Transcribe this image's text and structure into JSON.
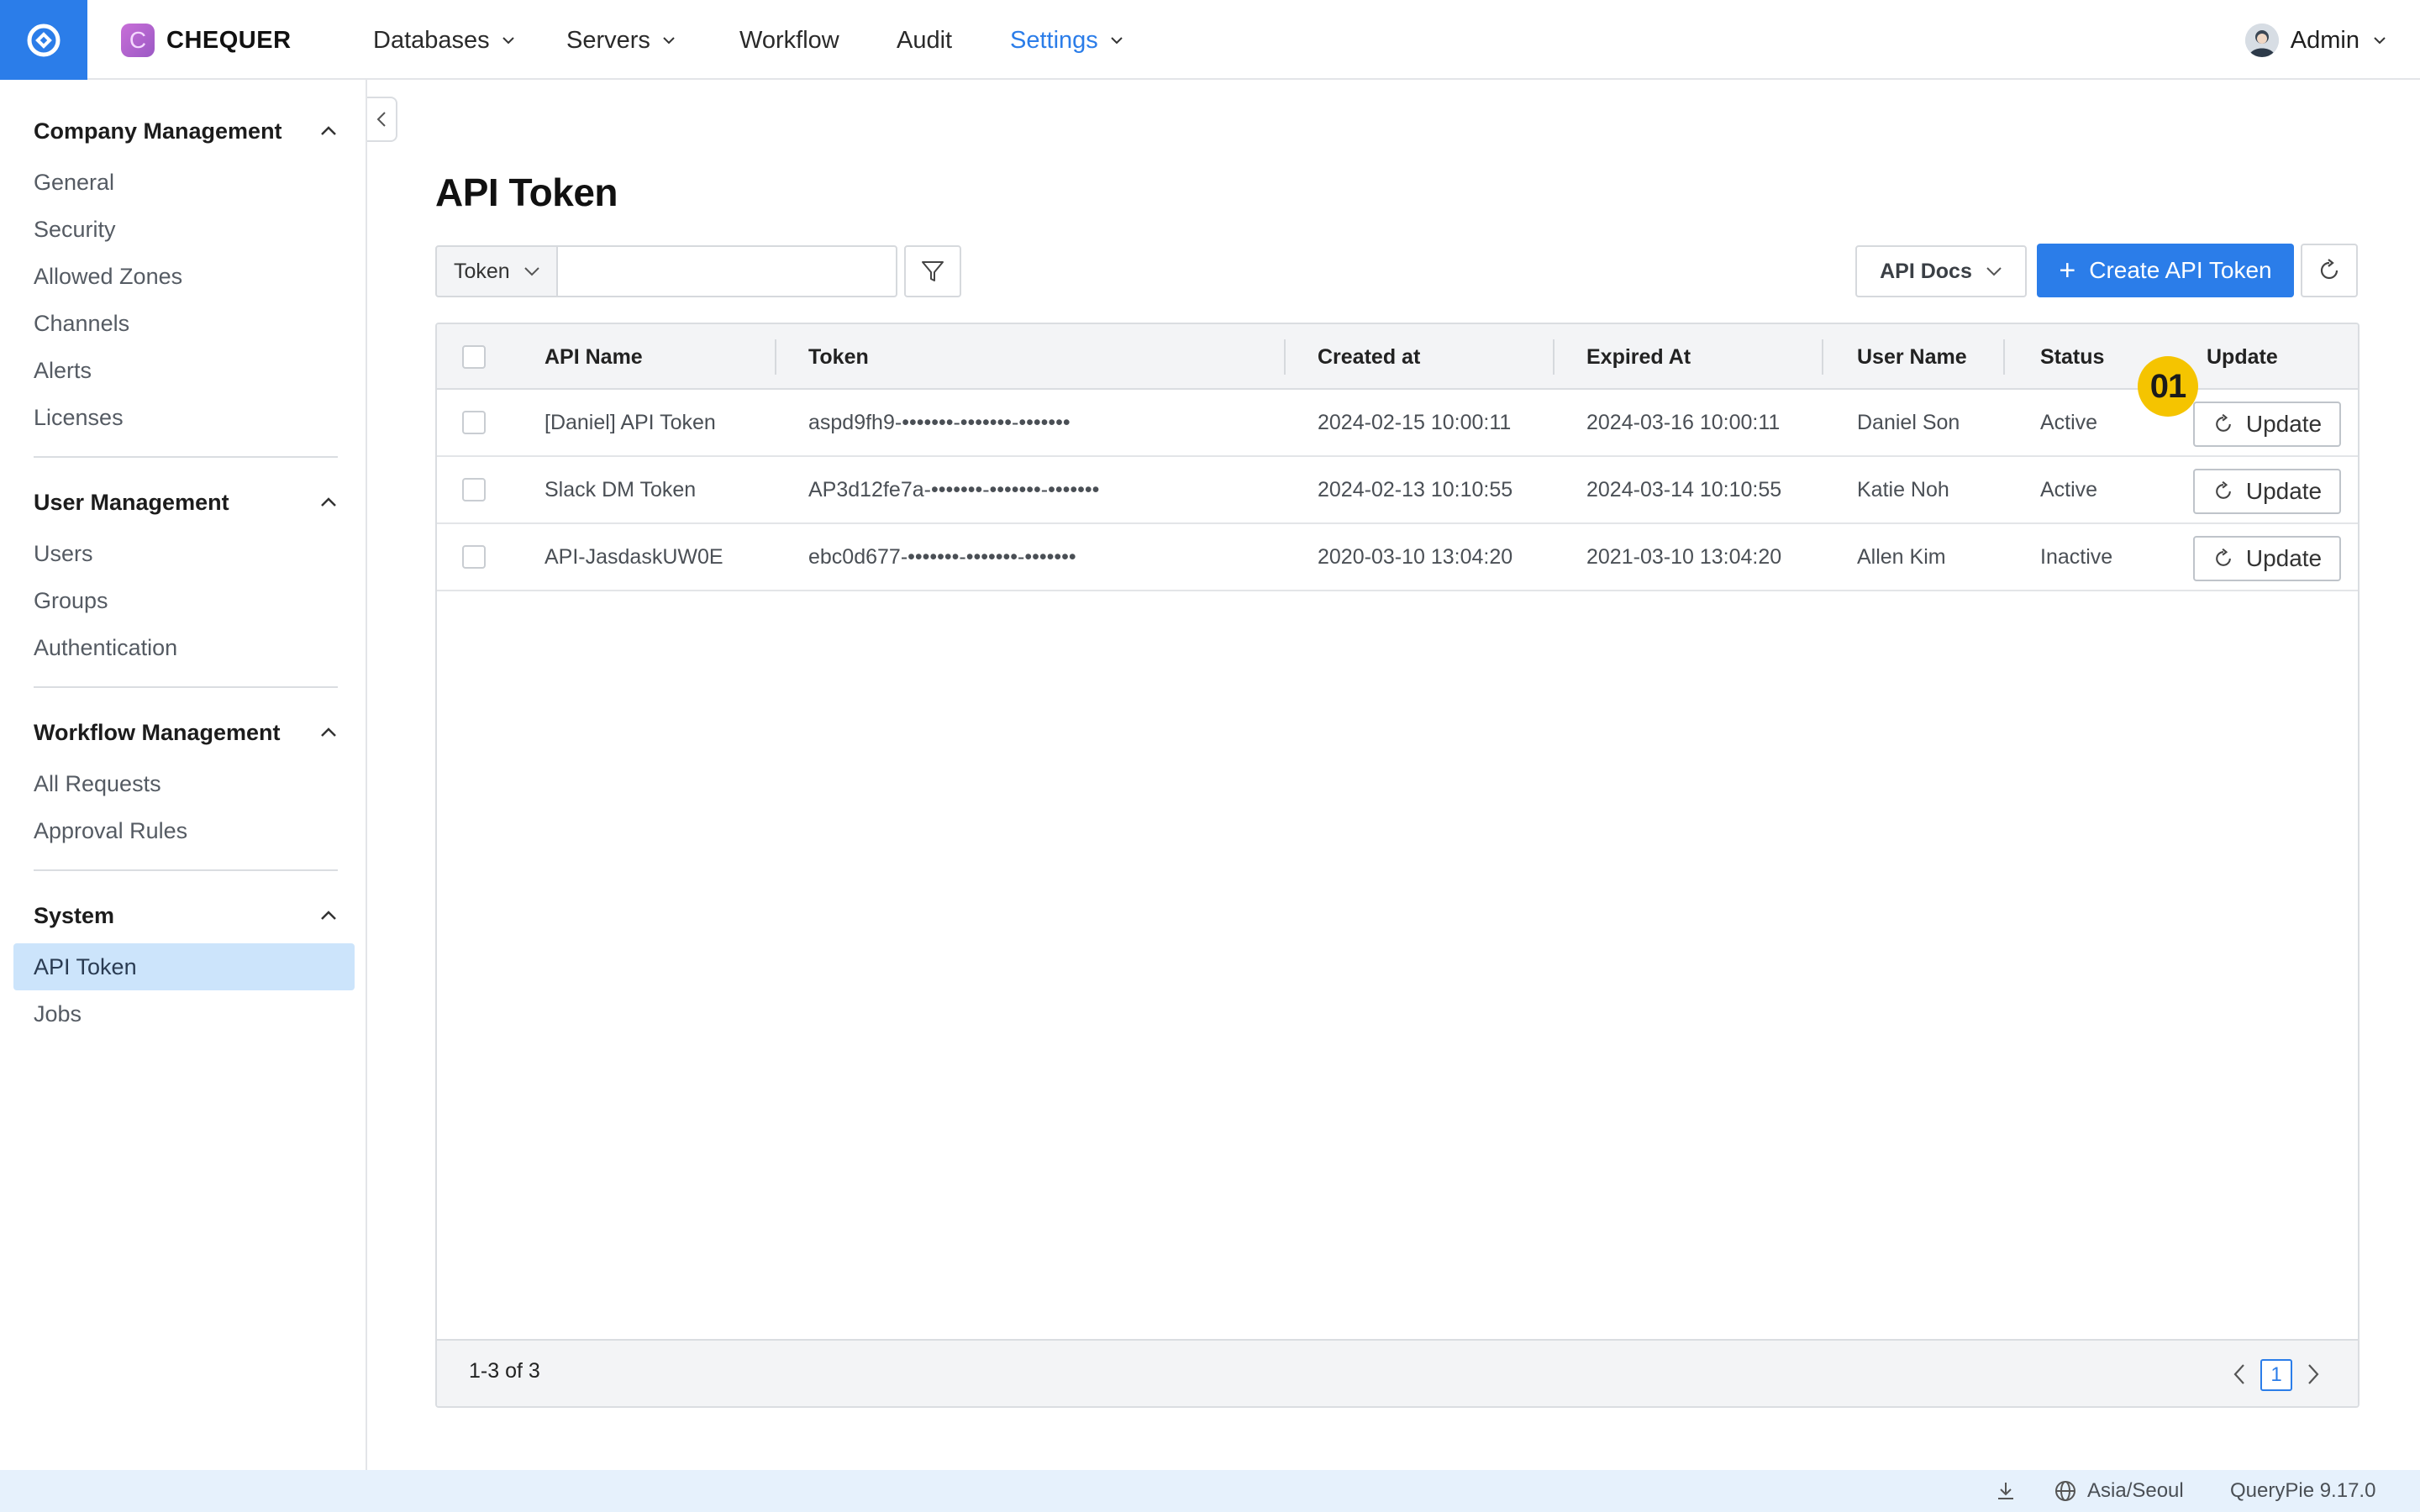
{
  "brand": {
    "name": "CHEQUER",
    "logo_letter": "C"
  },
  "nav": {
    "items": [
      {
        "label": "Databases",
        "has_dropdown": true
      },
      {
        "label": "Servers",
        "has_dropdown": true
      },
      {
        "label": "Workflow",
        "has_dropdown": false
      },
      {
        "label": "Audit",
        "has_dropdown": false
      },
      {
        "label": "Settings",
        "has_dropdown": true,
        "active": true
      }
    ],
    "user": {
      "name": "Admin"
    }
  },
  "sidebar": {
    "groups": [
      {
        "title": "Company Management",
        "items": [
          "General",
          "Security",
          "Allowed Zones",
          "Channels",
          "Alerts",
          "Licenses"
        ]
      },
      {
        "title": "User Management",
        "items": [
          "Users",
          "Groups",
          "Authentication"
        ]
      },
      {
        "title": "Workflow Management",
        "items": [
          "All Requests",
          "Approval Rules"
        ]
      },
      {
        "title": "System",
        "items": [
          "API Token",
          "Jobs"
        ],
        "active_item": "API Token"
      }
    ]
  },
  "page": {
    "title": "API Token"
  },
  "toolbar": {
    "search_type": "Token",
    "search_value": "",
    "api_docs_label": "API Docs",
    "create_label": "Create API Token"
  },
  "table": {
    "columns": [
      "API Name",
      "Token",
      "Created at",
      "Expired At",
      "User Name",
      "Status",
      "Update"
    ],
    "rows": [
      {
        "api_name": "[Daniel] API Token",
        "token": "aspd9fh9-•••••••-•••••••-•••••••",
        "created_at": "2024-02-15 10:00:11",
        "expired_at": "2024-03-16 10:00:11",
        "user_name": "Daniel Son",
        "status": "Active",
        "update_label": "Update"
      },
      {
        "api_name": "Slack DM Token",
        "token": "AP3d12fe7a-•••••••-•••••••-•••••••",
        "created_at": "2024-02-13 10:10:55",
        "expired_at": "2024-03-14 10:10:55",
        "user_name": "Katie Noh",
        "status": "Active",
        "update_label": "Update"
      },
      {
        "api_name": "API-JasdaskUW0E",
        "token": "ebc0d677-•••••••-•••••••-•••••••",
        "created_at": "2020-03-10 13:04:20",
        "expired_at": "2021-03-10 13:04:20",
        "user_name": "Allen Kim",
        "status": "Inactive",
        "update_label": "Update"
      }
    ],
    "range_text": "1-3 of 3",
    "current_page": "1"
  },
  "annotation": {
    "badge": "01",
    "color": "#f5c400"
  },
  "statusbar": {
    "timezone": "Asia/Seoul",
    "version": "QueryPie 9.17.0"
  },
  "colors": {
    "accent": "#2b7de9",
    "sidebar_active": "#cce4fb",
    "statusbar": "#e6f1fc"
  }
}
